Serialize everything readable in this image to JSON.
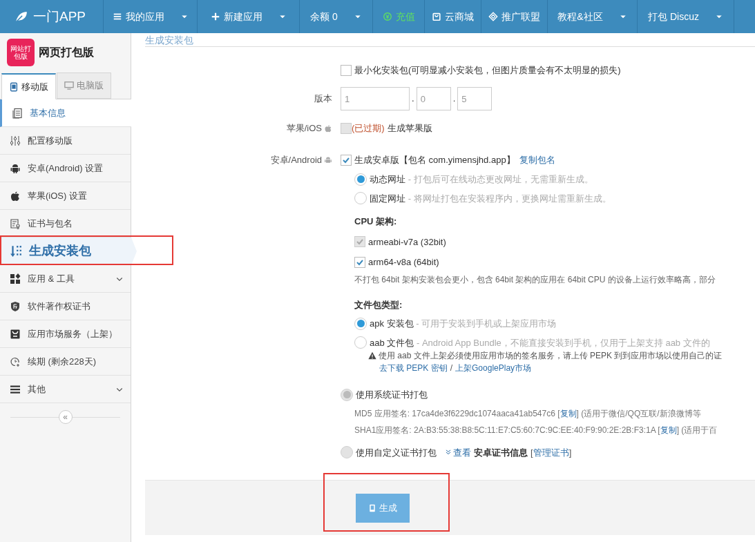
{
  "nav": {
    "logo": "一门APP",
    "items": [
      {
        "label": "我的应用",
        "color": "#ffffff",
        "dropdown": true
      },
      {
        "label": "新建应用",
        "color": "#ffffff",
        "dropdown": true
      },
      {
        "label": "余额 0",
        "color": "#ffffff",
        "dropdown": true
      },
      {
        "label": "充值",
        "color": "#5fe05f",
        "dropdown": false
      },
      {
        "label": "云商城",
        "color": "#ffffff",
        "dropdown": false
      },
      {
        "label": "推广联盟",
        "color": "#ffffff",
        "dropdown": false
      },
      {
        "label": "教程&社区",
        "color": "#ffffff",
        "dropdown": true
      },
      {
        "label": "打包 Discuz",
        "color": "#ffffff",
        "dropdown": true
      }
    ]
  },
  "sidebar": {
    "app_logo_text": "网站打包版",
    "app_name": "网页打包版",
    "tabs": [
      {
        "label": "移动版",
        "selected": true
      },
      {
        "label": "电脑版",
        "selected": false
      }
    ],
    "items": [
      {
        "label": "基本信息",
        "current": true,
        "selected": false,
        "expandable": false
      },
      {
        "label": "配置移动版",
        "current": false,
        "selected": false,
        "expandable": false
      },
      {
        "label": "安卓(Android) 设置",
        "current": false,
        "selected": false,
        "expandable": false
      },
      {
        "label": "苹果(iOS) 设置",
        "current": false,
        "selected": false,
        "expandable": false
      },
      {
        "label": "证书与包名",
        "current": false,
        "selected": false,
        "expandable": false
      },
      {
        "label": "生成安装包",
        "current": false,
        "selected": true,
        "expandable": false
      },
      {
        "label": "应用 & 工具",
        "current": false,
        "selected": false,
        "expandable": true
      },
      {
        "label": "软件著作权证书",
        "current": false,
        "selected": false,
        "expandable": false
      },
      {
        "label": "应用市场服务（上架）",
        "current": false,
        "selected": false,
        "expandable": false
      },
      {
        "label": "续期 (剩余228天)",
        "current": false,
        "selected": false,
        "expandable": false
      },
      {
        "label": "其他",
        "current": false,
        "selected": false,
        "expandable": true
      }
    ],
    "collapse": "«"
  },
  "main": {
    "section_title": "生成安装包",
    "minimize": {
      "label": "最小化安装包(可明显减小安装包，但图片质量会有不太明显的损失)",
      "checked": false
    },
    "version": {
      "label": "版本",
      "parts": [
        "1",
        "0",
        "5"
      ],
      "separator": "."
    },
    "ios": {
      "label": "苹果/iOS",
      "checked": false,
      "disabled": true,
      "status": "(已过期)",
      "text": "生成苹果版"
    },
    "android": {
      "label": "安卓/Android",
      "checked": true,
      "text": "生成安卓版【包名 com.yimensjhd.app】",
      "link": "复制包名",
      "url_modes": [
        {
          "label": "动态网址",
          "desc": "- 打包后可在线动态更改网址，无需重新生成。",
          "selected": true
        },
        {
          "label": "固定网址",
          "desc": "- 将网址打包在安装程序内，更换网址需重新生成。",
          "selected": false
        }
      ],
      "cpu_heading": "CPU 架构:",
      "cpu": [
        {
          "label": "armeabi-v7a (32bit)",
          "checked": true,
          "disabled": true
        },
        {
          "label": "arm64-v8a (64bit)",
          "checked": true,
          "disabled": false
        }
      ],
      "cpu_note": "不打包 64bit 架构安装包会更小，包含 64bit 架构的应用在 64bit CPU 的设备上运行效率略高，部分",
      "file_heading": "文件包类型:",
      "file_types": [
        {
          "label": "apk 安装包",
          "desc": "- 可用于安装到手机或上架应用市场",
          "selected": true
        },
        {
          "label": "aab 文件包",
          "desc": "- Android App Bundle，不能直接安装到手机，仅用于上架支持 aab 文件的",
          "selected": false
        }
      ],
      "warning": "使用 aab 文件上架必须使用应用市场的签名服务，请上传 PEPK 到到应用市场以使用自己的证",
      "warning_links": [
        "去下载 PEPK 密钥",
        "上架GooglePlay市场"
      ],
      "warning_sep": "/",
      "certs": [
        {
          "label": "使用系统证书打包",
          "selected": true,
          "disabled": true
        },
        {
          "label": "使用自定义证书打包",
          "selected": false,
          "disabled": true
        }
      ],
      "signatures": [
        {
          "prefix": "MD5 应用签名: 17ca4de3f6229dc1074aaca41ab547c6 [",
          "link": "复制",
          "suffix": "] (适用于微信/QQ互联/新浪微博等"
        },
        {
          "prefix": "SHA1应用签名: 2A:B3:55:38:B8:5C:11:E7:C5:60:7C:9C:EE:40:F9:90:2E:2B:F3:1A [",
          "link": "复制",
          "suffix": "] (适用于百"
        }
      ],
      "view_link": "查看",
      "view_bold": "安卓证书信息",
      "manage_open": "[",
      "manage_link": "管理证书",
      "manage_close": "]"
    },
    "button": "生成"
  }
}
